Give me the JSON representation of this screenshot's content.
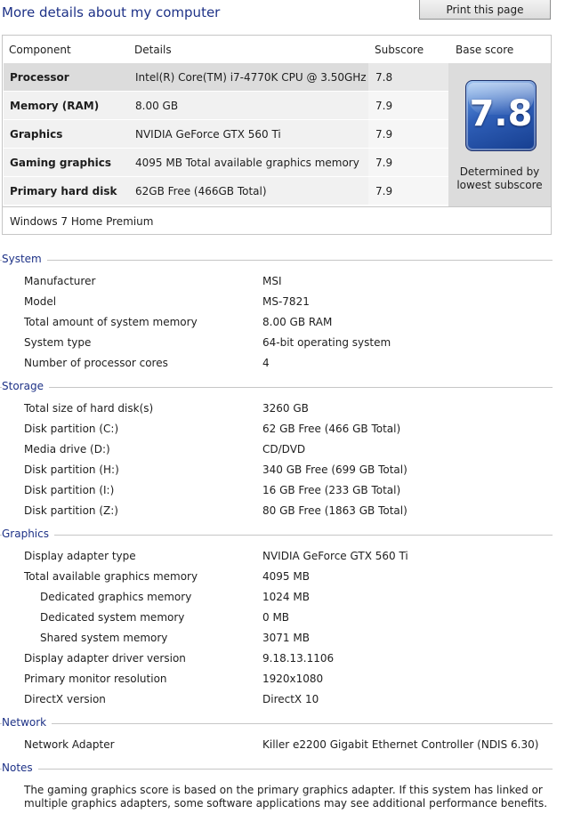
{
  "title": "More details about my computer",
  "print_button": "Print this page",
  "score_table": {
    "headers": {
      "component": "Component",
      "details": "Details",
      "subscore": "Subscore",
      "base_score": "Base score"
    },
    "rows": [
      {
        "component": "Processor",
        "details": "Intel(R) Core(TM) i7-4770K CPU @ 3.50GHz",
        "subscore": "7.8"
      },
      {
        "component": "Memory (RAM)",
        "details": "8.00 GB",
        "subscore": "7.9"
      },
      {
        "component": "Graphics",
        "details": "NVIDIA GeForce GTX 560 Ti",
        "subscore": "7.9"
      },
      {
        "component": "Gaming graphics",
        "details": "4095 MB Total available graphics memory",
        "subscore": "7.9"
      },
      {
        "component": "Primary hard disk",
        "details": "62GB Free (466GB Total)",
        "subscore": "7.9"
      }
    ],
    "base_score": "7.8",
    "determined_line1": "Determined by",
    "determined_line2": "lowest subscore",
    "os": "Windows 7 Home Premium"
  },
  "sections": {
    "system": {
      "label": "System",
      "items": [
        {
          "key": "Manufacturer",
          "value": "MSI"
        },
        {
          "key": "Model",
          "value": "MS-7821"
        },
        {
          "key": "Total amount of system memory",
          "value": "8.00 GB RAM"
        },
        {
          "key": "System type",
          "value": "64-bit operating system"
        },
        {
          "key": "Number of processor cores",
          "value": "4"
        }
      ]
    },
    "storage": {
      "label": "Storage",
      "items": [
        {
          "key": "Total size of hard disk(s)",
          "value": "3260 GB"
        },
        {
          "key": "Disk partition (C:)",
          "value": "62 GB Free (466 GB Total)"
        },
        {
          "key": "Media drive (D:)",
          "value": "CD/DVD"
        },
        {
          "key": "Disk partition (H:)",
          "value": "340 GB Free (699 GB Total)"
        },
        {
          "key": "Disk partition (I:)",
          "value": "16 GB Free (233 GB Total)"
        },
        {
          "key": "Disk partition (Z:)",
          "value": "80 GB Free (1863 GB Total)"
        }
      ]
    },
    "graphics": {
      "label": "Graphics",
      "items": [
        {
          "key": "Display adapter type",
          "value": "NVIDIA GeForce GTX 560 Ti"
        },
        {
          "key": "Total available graphics memory",
          "value": "4095 MB"
        },
        {
          "key": "Dedicated graphics memory",
          "value": "1024 MB"
        },
        {
          "key": "Dedicated system memory",
          "value": "0 MB"
        },
        {
          "key": "Shared system memory",
          "value": "3071 MB"
        },
        {
          "key": "Display adapter driver version",
          "value": "9.18.13.1106"
        },
        {
          "key": "Primary monitor resolution",
          "value": "1920x1080"
        },
        {
          "key": "DirectX version",
          "value": "DirectX 10"
        }
      ]
    },
    "network": {
      "label": "Network",
      "items": [
        {
          "key": "Network Adapter",
          "value": "Killer e2200 Gigabit Ethernet Controller (NDIS 6.30)"
        }
      ]
    },
    "notes": {
      "label": "Notes",
      "text": "The gaming graphics score is based on the primary graphics adapter. If this system has linked or multiple graphics adapters, some software applications may see additional performance benefits."
    }
  }
}
